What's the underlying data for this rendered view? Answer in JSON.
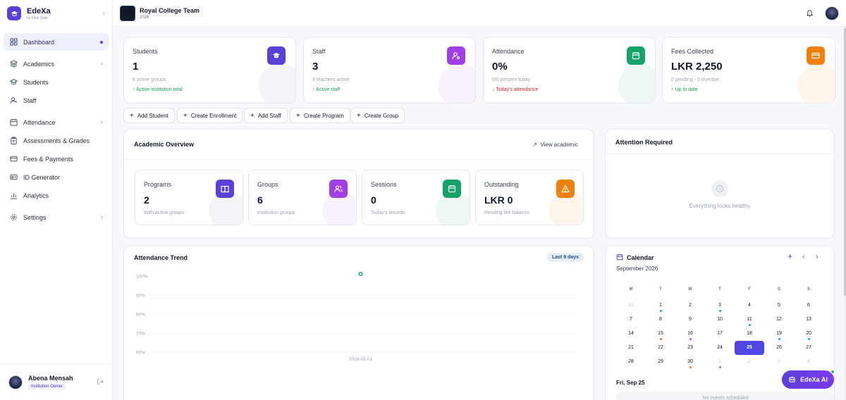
{
  "brand": {
    "name": "EdeXa",
    "subtitle": "by Flow Suite"
  },
  "sidebar": {
    "items": [
      {
        "label": "Dashboard",
        "icon": "dashboard-icon"
      },
      {
        "label": "Academics",
        "icon": "layers-icon"
      },
      {
        "label": "Students",
        "icon": "graduation-cap-icon"
      },
      {
        "label": "Staff",
        "icon": "user-icon"
      },
      {
        "label": "Attendance",
        "icon": "calendar-icon"
      },
      {
        "label": "Assessments & Grades",
        "icon": "clipboard-icon"
      },
      {
        "label": "Fees & Payments",
        "icon": "credit-card-icon"
      },
      {
        "label": "ID Generator",
        "icon": "id-card-icon"
      },
      {
        "label": "Analytics",
        "icon": "bar-chart-icon"
      },
      {
        "label": "Settings",
        "icon": "gear-icon"
      }
    ]
  },
  "user": {
    "name": "Abena Mensah",
    "role": "Institution Owner"
  },
  "team": {
    "name": "Royal College Team",
    "year": "2026"
  },
  "stats": [
    {
      "label": "Students",
      "value": "1",
      "sub": "6 active groups",
      "trend": "↑ Active institution total",
      "trend_color": "#16a34a",
      "icon": "graduation-cap-icon",
      "color": "#5b3fd9",
      "blob": "#f3f3f8"
    },
    {
      "label": "Staff",
      "value": "3",
      "sub": "3 teachers active",
      "trend": "↑ Active staff",
      "trend_color": "#16a34a",
      "icon": "user-gear-icon",
      "color": "#a23ee6",
      "blob": "#f8f2fc"
    },
    {
      "label": "Attendance",
      "value": "0%",
      "sub": "0/0 present today",
      "trend": "↓ Today's attendance",
      "trend_color": "#dc2626",
      "icon": "calendar-icon",
      "color": "#16a36a",
      "blob": "#eff7f2"
    },
    {
      "label": "Fees Collected",
      "value": "LKR 2,250",
      "sub": "0 pending - 0 overdue",
      "trend": "↑ Up to date",
      "trend_color": "#16a34a",
      "icon": "credit-card-icon",
      "color": "#f07f0c",
      "blob": "#fdf4ec"
    }
  ],
  "actions": [
    "Add Student",
    "Create Enrollment",
    "Add Staff",
    "Create Program",
    "Create Group"
  ],
  "academic": {
    "title": "Academic Overview",
    "link": "View academic",
    "items": [
      {
        "label": "Programs",
        "value": "2",
        "sub": "With active groups",
        "icon": "book-icon",
        "color": "#5b3fd9",
        "blob": "#f3f3f8"
      },
      {
        "label": "Groups",
        "value": "6",
        "sub": "Institution groups",
        "icon": "users-icon",
        "color": "#a23ee6",
        "blob": "#f8f2fc"
      },
      {
        "label": "Sessions",
        "value": "0",
        "sub": "Today's records",
        "icon": "calendar-icon",
        "color": "#16a36a",
        "blob": "#eff7f2"
      },
      {
        "label": "Outstanding",
        "value": "LKR 0",
        "sub": "Pending fee balance",
        "icon": "warning-icon",
        "color": "#f07f0c",
        "blob": "#fdf4ec"
      }
    ]
  },
  "attention": {
    "title": "Attention Required",
    "empty_text": "Everything looks healthy"
  },
  "trend": {
    "title": "Attendance Trend",
    "badge": "Last 9 days"
  },
  "chart_data": {
    "type": "line",
    "x": [
      "2026-09-01"
    ],
    "series": [
      {
        "values": [
          100
        ]
      }
    ],
    "yticks": [
      "100%",
      "90%",
      "80%",
      "70%",
      "60%"
    ],
    "ylim": [
      60,
      100
    ],
    "color": "#16a36a"
  },
  "calendar": {
    "title": "Calendar",
    "month": "September 2026",
    "weekdays": [
      "M",
      "T",
      "W",
      "T",
      "F",
      "S",
      "S"
    ],
    "weeks": [
      [
        {
          "d": "31",
          "m": true
        },
        {
          "d": "1",
          "dot": "#0ea5e9"
        },
        {
          "d": "2"
        },
        {
          "d": "3",
          "dot": "#0ea5e9"
        },
        {
          "d": "4"
        },
        {
          "d": "5"
        },
        {
          "d": "6"
        }
      ],
      [
        {
          "d": "7"
        },
        {
          "d": "8"
        },
        {
          "d": "9"
        },
        {
          "d": "10"
        },
        {
          "d": "11",
          "dot": "#0ea5e9"
        },
        {
          "d": "12"
        },
        {
          "d": "13"
        }
      ],
      [
        {
          "d": "14"
        },
        {
          "d": "15",
          "dot": "#f97316"
        },
        {
          "d": "16",
          "dot": "#a855f7"
        },
        {
          "d": "17"
        },
        {
          "d": "18"
        },
        {
          "d": "19",
          "dot": "#0ea5e9"
        },
        {
          "d": "20",
          "dot": "#0ea5e9"
        }
      ],
      [
        {
          "d": "21"
        },
        {
          "d": "22"
        },
        {
          "d": "23"
        },
        {
          "d": "24"
        },
        {
          "d": "25",
          "sel": true
        },
        {
          "d": "26"
        },
        {
          "d": "27"
        }
      ],
      [
        {
          "d": "28"
        },
        {
          "d": "29"
        },
        {
          "d": "30",
          "dot": "#f97316"
        },
        {
          "d": "1",
          "m": true,
          "dot": "#a855f7"
        },
        {
          "d": "2",
          "m": true
        },
        {
          "d": "3",
          "m": true
        },
        {
          "d": "4",
          "m": true
        }
      ]
    ],
    "selected_label": "Fri, Sep 25",
    "no_events": "No events scheduled"
  },
  "ai": {
    "label": "EdeXa AI"
  }
}
